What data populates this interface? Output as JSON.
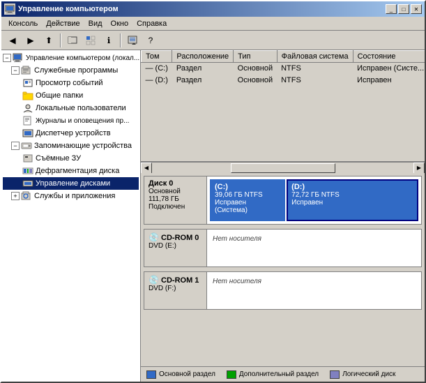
{
  "window": {
    "title": "Управление компьютером",
    "title_icon": "🖥"
  },
  "title_buttons": {
    "minimize": "_",
    "maximize": "□",
    "close": "✕"
  },
  "menu": {
    "items": [
      "Консоль",
      "Действие",
      "Вид",
      "Окно",
      "Справка"
    ]
  },
  "table": {
    "columns": [
      "Том",
      "Расположение",
      "Тип",
      "Файловая система",
      "Состояние"
    ],
    "rows": [
      {
        "icon": "—",
        "tom": "(C:)",
        "rasp": "Раздел",
        "tip": "Основной",
        "fs": "NTFS",
        "status": "Исправен (Систе..."
      },
      {
        "icon": "—",
        "tom": "(D:)",
        "rasp": "Раздел",
        "tip": "Основной",
        "fs": "NTFS",
        "status": "Исправен"
      }
    ]
  },
  "sidebar": {
    "root_label": "Управление компьютером (локал...",
    "items": [
      {
        "id": "slujebnye",
        "label": "Служебные программы",
        "level": 1,
        "expanded": true
      },
      {
        "id": "prosmotr",
        "label": "Просмотр событий",
        "level": 2
      },
      {
        "id": "obshie",
        "label": "Общие папки",
        "level": 2
      },
      {
        "id": "lokalnye",
        "label": "Локальные пользователи",
        "level": 2
      },
      {
        "id": "jurnaly",
        "label": "Журналы и оповещения пр...",
        "level": 2
      },
      {
        "id": "dispatcher",
        "label": "Диспетчер устройств",
        "level": 2
      },
      {
        "id": "zapominayuschie",
        "label": "Запоминающие устройства",
        "level": 1,
        "expanded": true
      },
      {
        "id": "semnye",
        "label": "Съёмные ЗУ",
        "level": 2
      },
      {
        "id": "defrag",
        "label": "Дефрагментация диска",
        "level": 2
      },
      {
        "id": "upravlenie_diskami",
        "label": "Управление дисками",
        "level": 2,
        "selected": true
      },
      {
        "id": "sluzhby",
        "label": "Службы и приложения",
        "level": 1
      }
    ]
  },
  "disks": [
    {
      "id": "disk0",
      "name": "Диск 0",
      "type": "Основной",
      "size": "111,78 ГБ",
      "status": "Подключен",
      "partitions": [
        {
          "label": "(C:)",
          "size": "39,06 ГБ NTFS",
          "status": "Исправен (Система)",
          "type": "primary",
          "flex": 35
        },
        {
          "label": "(D:)",
          "size": "72,72 ГБ NTFS",
          "status": "Исправен",
          "type": "primary-selected",
          "flex": 65
        }
      ]
    },
    {
      "id": "cdrom0",
      "name": "CD-ROM 0",
      "type": "DVD (E:)",
      "size": "",
      "status": "",
      "no_media": "Нет носителя",
      "is_cdrom": true
    },
    {
      "id": "cdrom1",
      "name": "CD-ROM 1",
      "type": "DVD (F:)",
      "size": "",
      "status": "",
      "no_media": "Нет носителя",
      "is_cdrom": true
    }
  ],
  "legend": [
    {
      "label": "Основной раздел",
      "color": "#316ac5"
    },
    {
      "label": "Дополнительный раздел",
      "color": "#00a000"
    },
    {
      "label": "Логический диск",
      "color": "#8080c0"
    }
  ]
}
